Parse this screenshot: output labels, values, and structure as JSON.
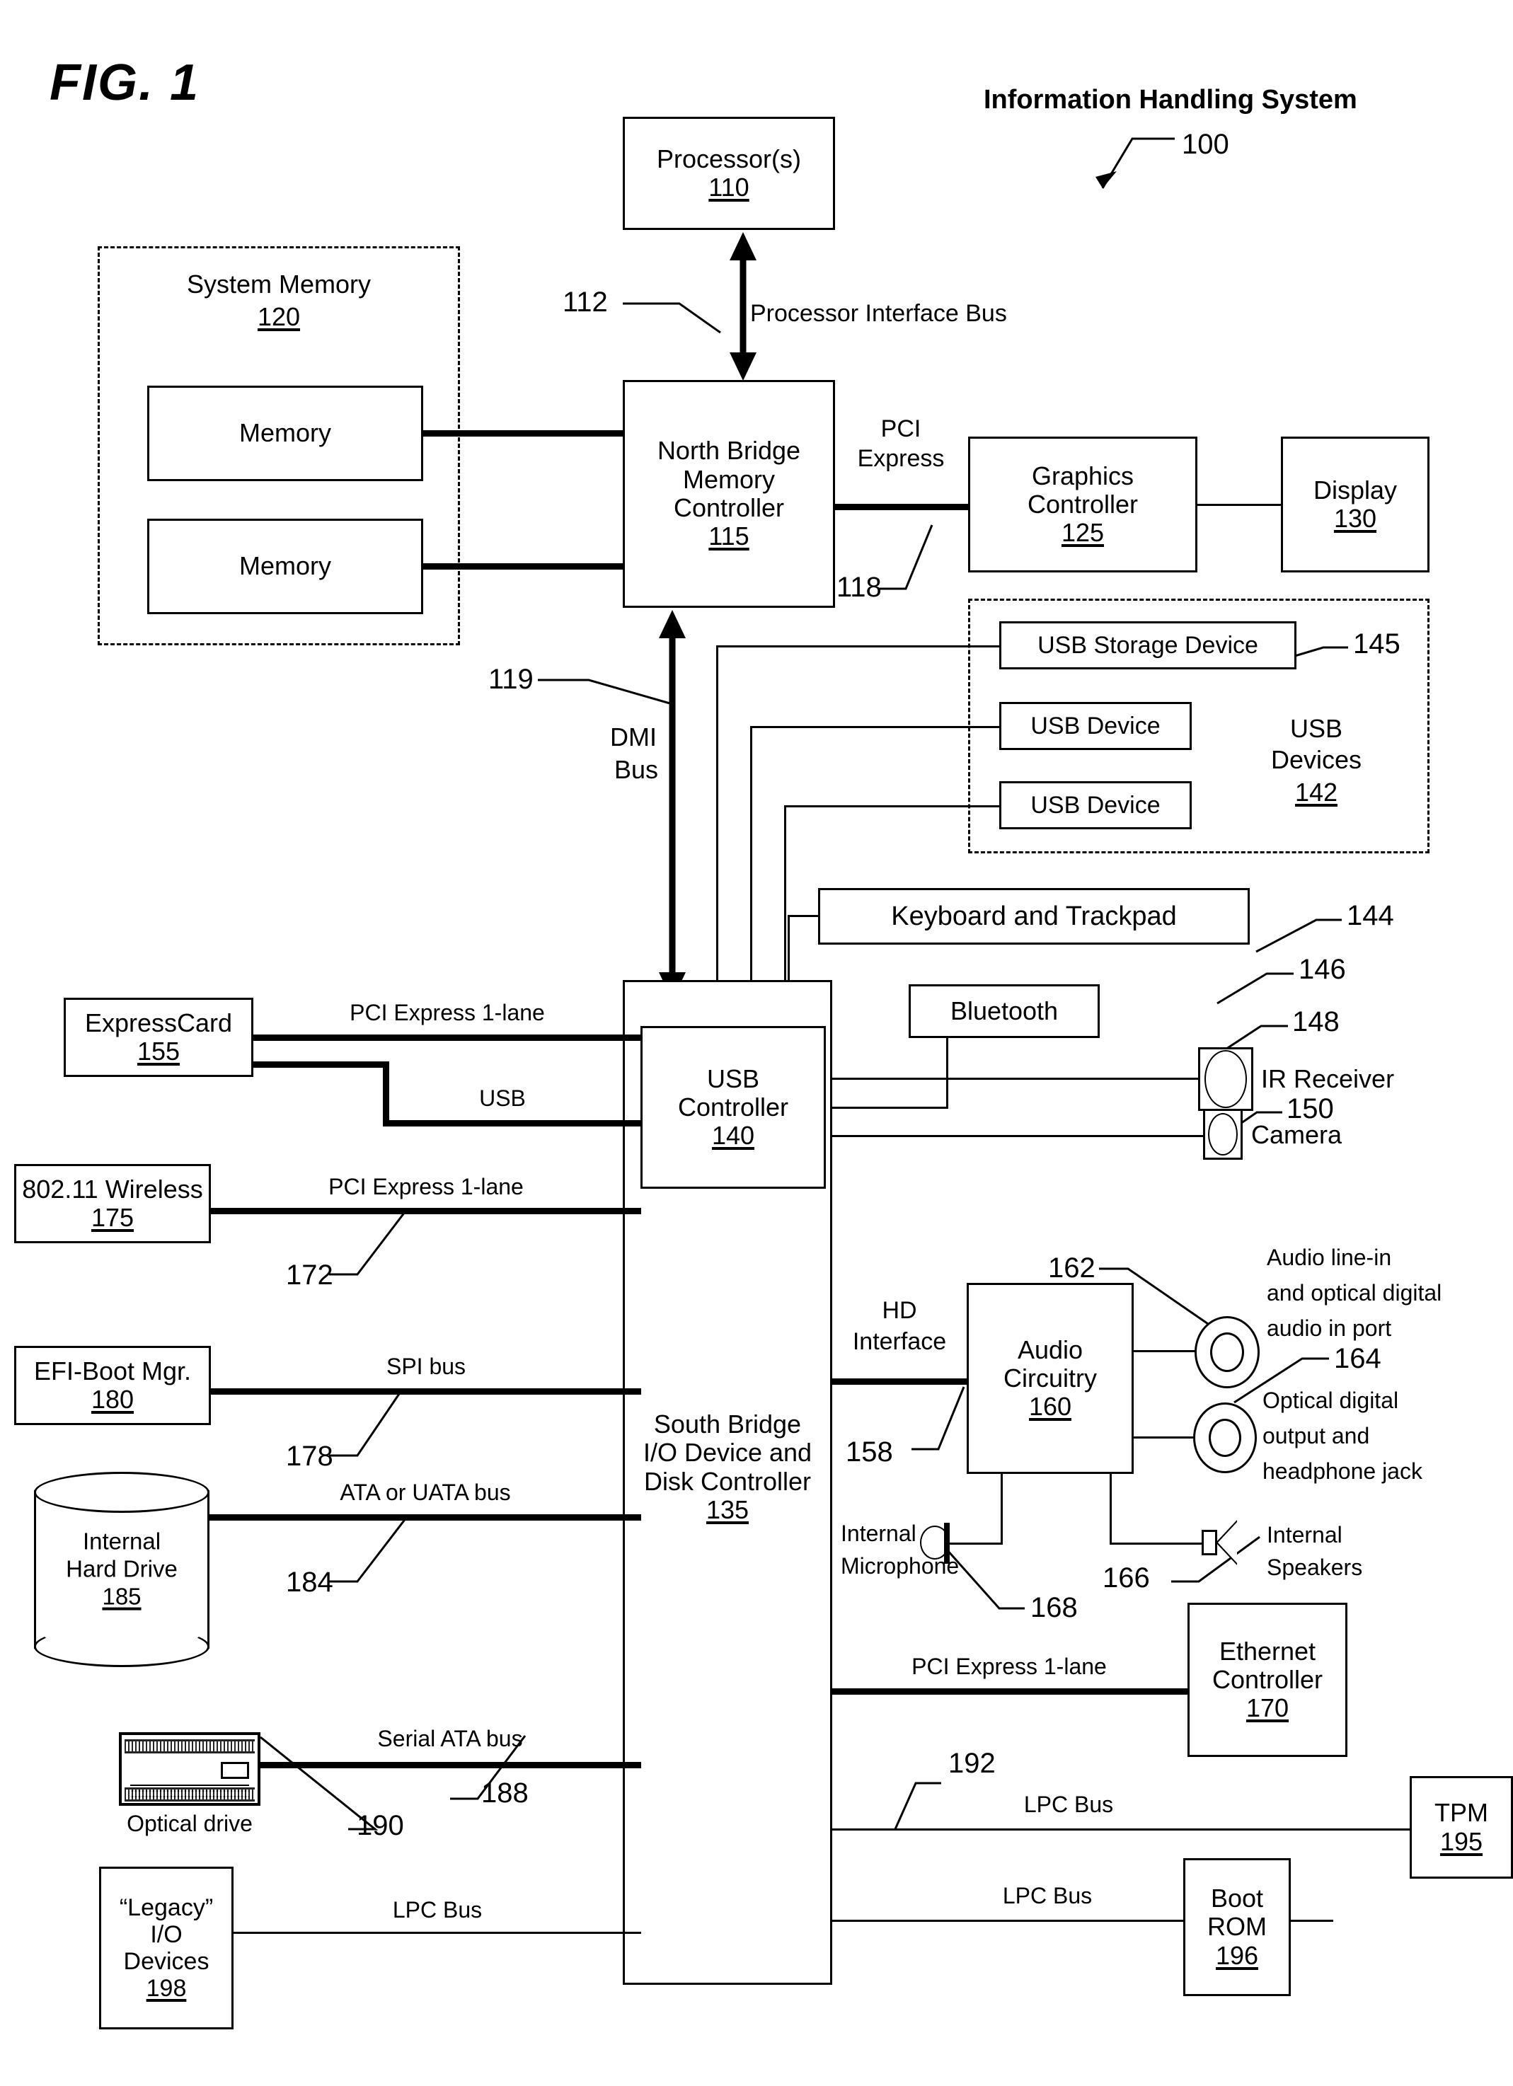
{
  "figure": {
    "label": "FIG. 1",
    "system_title": "Information Handling System",
    "system_ref": "100"
  },
  "blocks": {
    "processor": {
      "title": "Processor(s)",
      "ref": "110"
    },
    "system_memory": {
      "title": "System Memory",
      "ref": "120"
    },
    "memory_1": {
      "title": "Memory"
    },
    "memory_2": {
      "title": "Memory"
    },
    "north_bridge": {
      "line1": "North Bridge",
      "line2": "Memory",
      "line3": "Controller",
      "ref": "115"
    },
    "graphics": {
      "line1": "Graphics",
      "line2": "Controller",
      "ref": "125"
    },
    "display": {
      "title": "Display",
      "ref": "130"
    },
    "usb_storage": {
      "title": "USB Storage Device",
      "ref": "145"
    },
    "usb_device_1": {
      "title": "USB Device"
    },
    "usb_device_2": {
      "title": "USB Device"
    },
    "usb_devices_group": {
      "line1": "USB",
      "line2": "Devices",
      "ref": "142"
    },
    "keyboard": {
      "title": "Keyboard and Trackpad",
      "ref": "144"
    },
    "bluetooth": {
      "title": "Bluetooth",
      "ref": "146"
    },
    "ir_receiver": {
      "title": "IR Receiver",
      "ref": "148"
    },
    "camera": {
      "title": "Camera",
      "ref": "150"
    },
    "usb_controller": {
      "line1": "USB",
      "line2": "Controller",
      "ref": "140"
    },
    "south_bridge": {
      "line1": "South Bridge",
      "line2": "I/O Device and",
      "line3": "Disk Controller",
      "ref": "135"
    },
    "expresscard": {
      "title": "ExpressCard",
      "ref": "155"
    },
    "wireless": {
      "title": "802.11 Wireless",
      "ref": "175"
    },
    "efi_boot_mgr": {
      "title": "EFI-Boot Mgr.",
      "ref": "180"
    },
    "hard_drive": {
      "line1": "Internal",
      "line2": "Hard Drive",
      "ref": "185"
    },
    "optical_drive": {
      "title": "Optical drive",
      "ref": "190"
    },
    "legacy_io": {
      "line1": "“Legacy”",
      "line2": "I/O",
      "line3": "Devices",
      "ref": "198"
    },
    "audio_circuitry": {
      "line1": "Audio",
      "line2": "Circuitry",
      "ref": "160"
    },
    "audio_line_in": {
      "line1": "Audio line-in",
      "line2": "and optical digital",
      "line3": "audio in port",
      "ref": "162"
    },
    "audio_out": {
      "line1": "Optical digital",
      "line2": "output and",
      "line3": "headphone jack",
      "ref": "164"
    },
    "internal_mic": {
      "line1": "Internal",
      "line2": "Microphone",
      "ref": "168"
    },
    "internal_speakers": {
      "line1": "Internal",
      "line2": "Speakers",
      "ref": "166"
    },
    "ethernet": {
      "line1": "Ethernet",
      "line2": "Controller",
      "ref": "170"
    },
    "tpm": {
      "title": "TPM",
      "ref": "195"
    },
    "boot_rom": {
      "line1": "Boot",
      "line2": "ROM",
      "ref": "196"
    }
  },
  "buses": {
    "processor_interface": {
      "label": "Processor Interface Bus",
      "ref": "112"
    },
    "pci_express": {
      "line1": "PCI",
      "line2": "Express",
      "ref": "118"
    },
    "dmi": {
      "line1": "DMI",
      "line2": "Bus",
      "ref": "119"
    },
    "pcie_1lane_express": {
      "label": "PCI Express 1-lane"
    },
    "usb": {
      "label": "USB"
    },
    "pcie_1lane_wireless": {
      "label": "PCI Express 1-lane",
      "ref": "172"
    },
    "spi": {
      "label": "SPI bus",
      "ref": "178"
    },
    "ata": {
      "label": "ATA or UATA bus",
      "ref": "184"
    },
    "serial_ata": {
      "label": "Serial ATA bus",
      "ref": "188"
    },
    "lpc_legacy": {
      "label": "LPC Bus"
    },
    "hd_interface": {
      "line1": "HD",
      "line2": "Interface",
      "ref": "158"
    },
    "pcie_1lane_ethernet": {
      "label": "PCI Express 1-lane"
    },
    "lpc_tpm": {
      "label": "LPC Bus",
      "ref": "192"
    },
    "lpc_bootrom": {
      "label": "LPC Bus"
    }
  },
  "colors": {
    "ink": "#000000",
    "paper": "#ffffff"
  }
}
